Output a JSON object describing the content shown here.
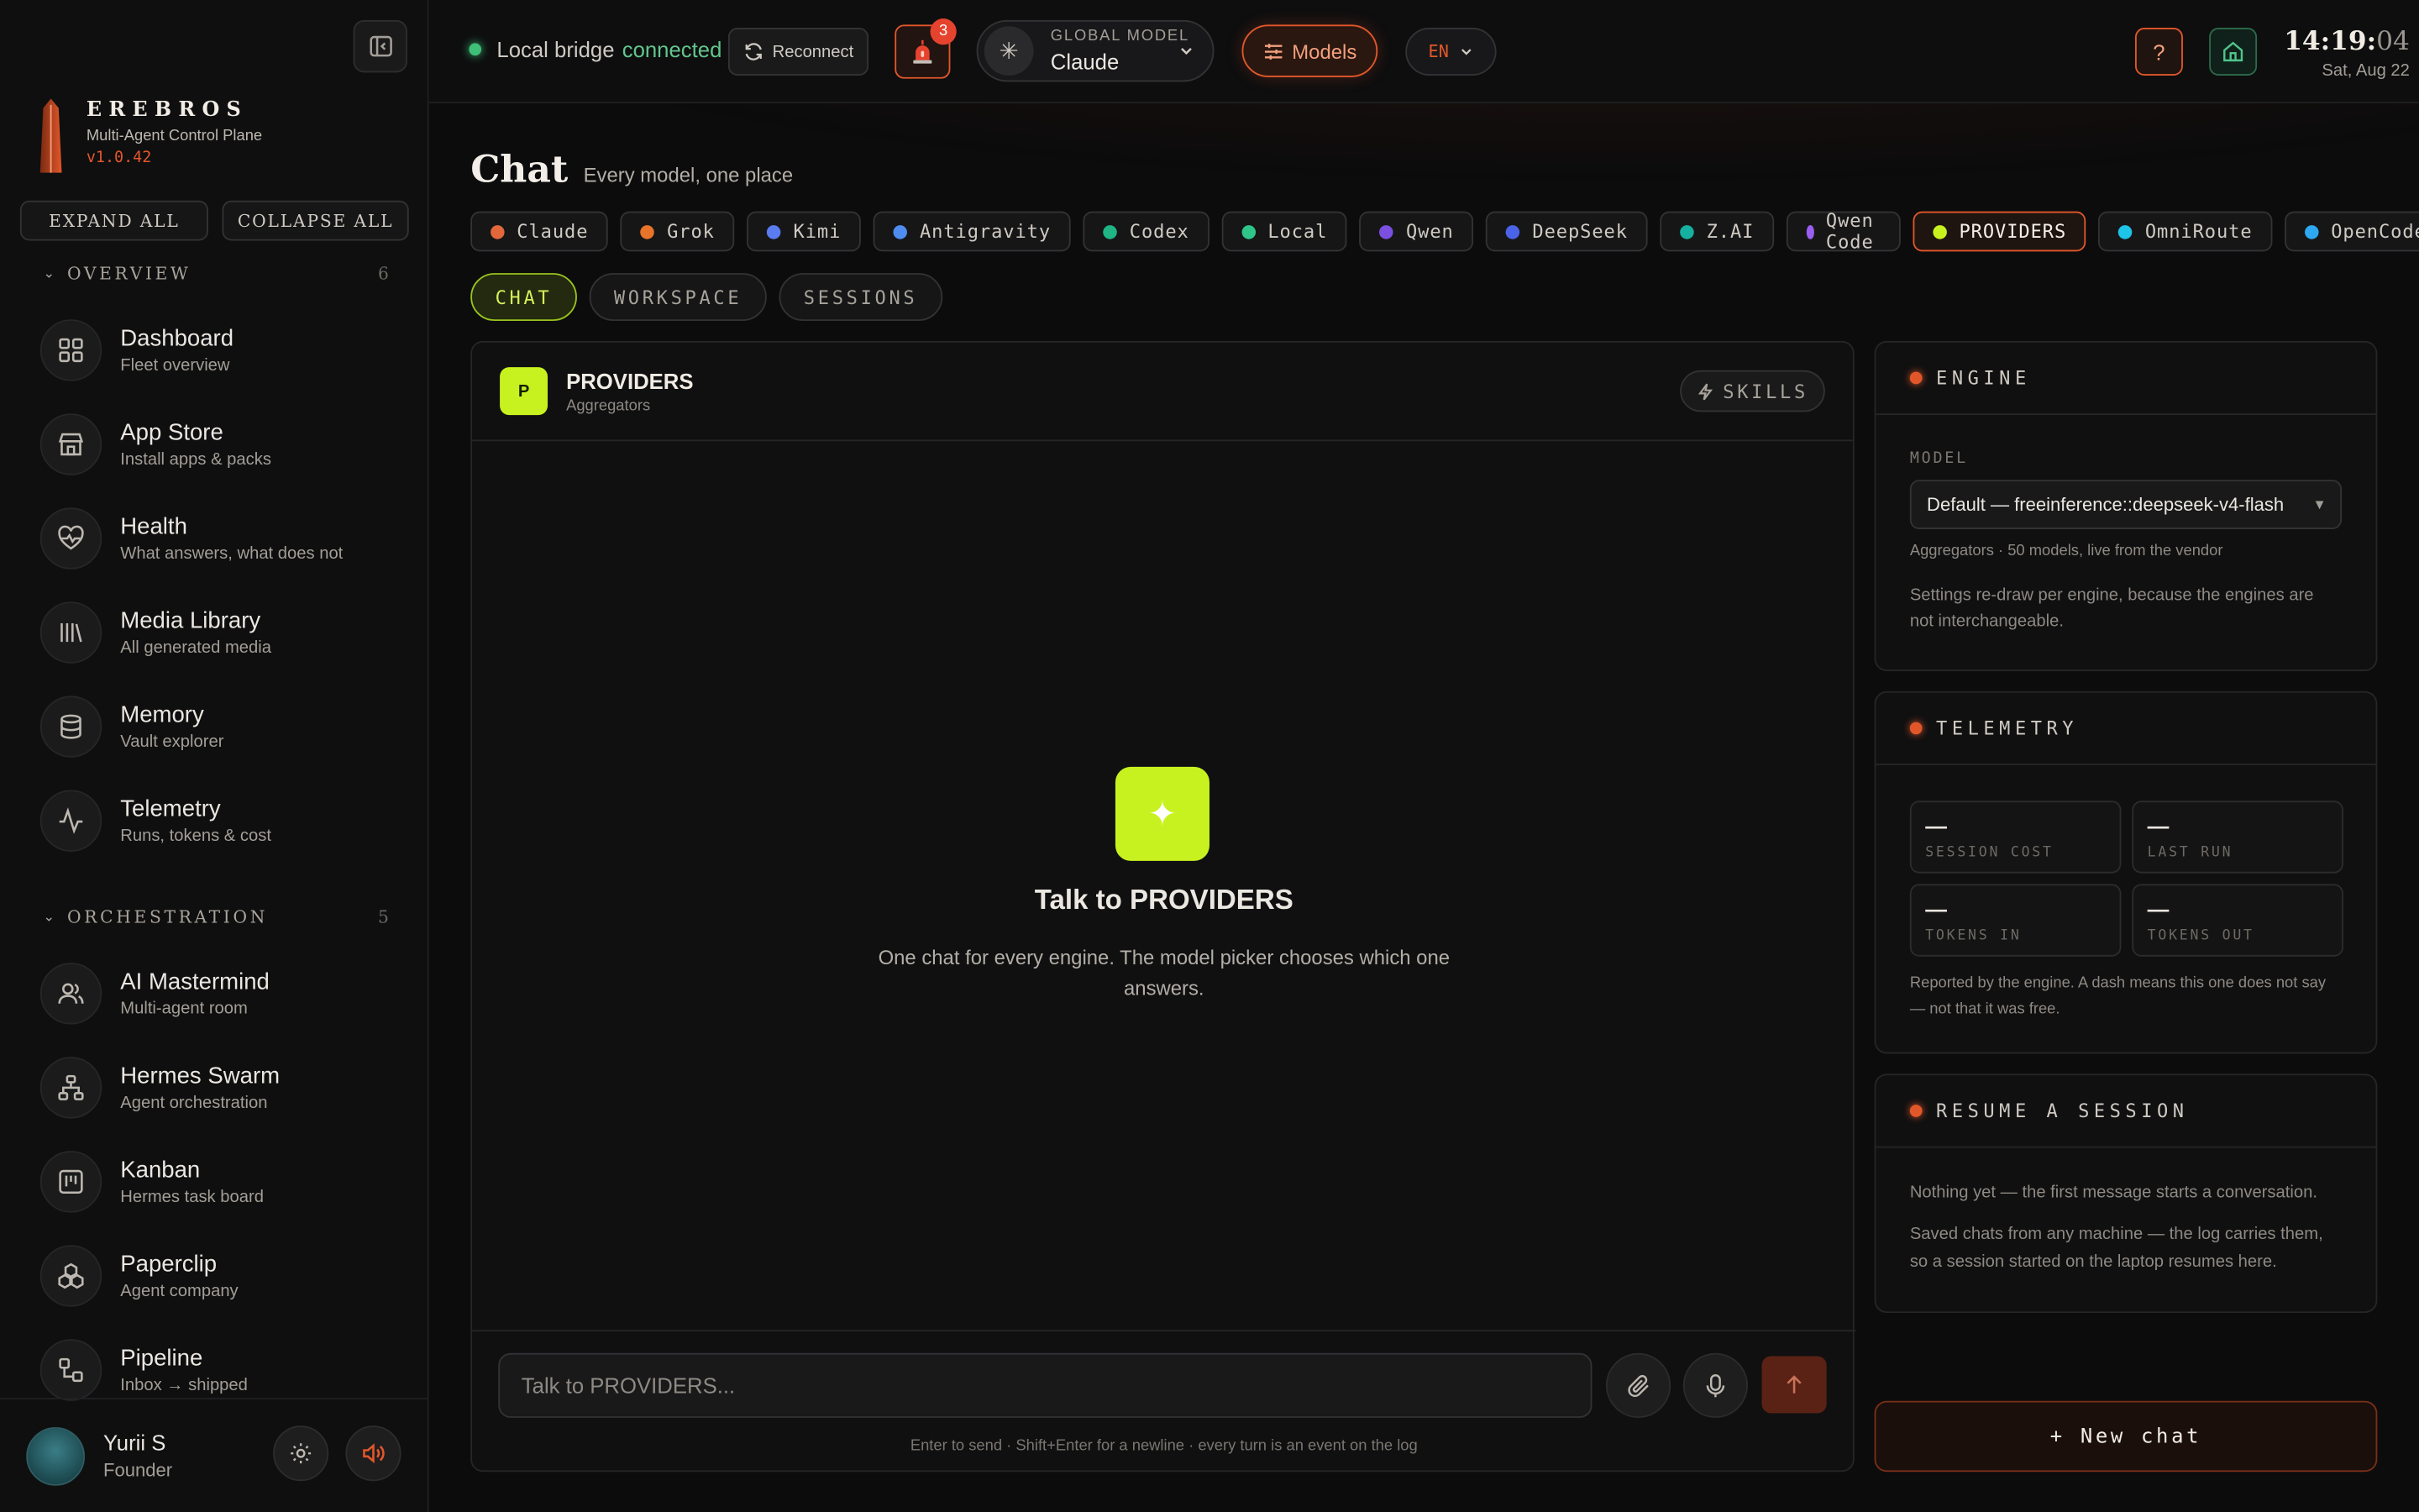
{
  "sidebar": {
    "brand": {
      "name": "EREBROS",
      "subtitle": "Multi-Agent Control Plane",
      "version": "v1.0.42"
    },
    "expand_label": "EXPAND ALL",
    "collapse_label": "COLLAPSE ALL",
    "groups": [
      {
        "label": "OVERVIEW",
        "count": "6",
        "items": [
          {
            "title": "Dashboard",
            "sub": "Fleet overview",
            "icon": "grid-icon"
          },
          {
            "title": "App Store",
            "sub": "Install apps & packs",
            "icon": "store-icon"
          },
          {
            "title": "Health",
            "sub": "What answers, what does not",
            "icon": "heart-pulse-icon"
          },
          {
            "title": "Media Library",
            "sub": "All generated media",
            "icon": "library-icon"
          },
          {
            "title": "Memory",
            "sub": "Vault explorer",
            "icon": "database-icon"
          },
          {
            "title": "Telemetry",
            "sub": "Runs, tokens & cost",
            "icon": "activity-icon"
          }
        ]
      },
      {
        "label": "ORCHESTRATION",
        "count": "5",
        "items": [
          {
            "title": "AI Mastermind",
            "sub": "Multi-agent room",
            "icon": "users-icon"
          },
          {
            "title": "Hermes Swarm",
            "sub": "Agent orchestration",
            "icon": "network-icon"
          },
          {
            "title": "Kanban",
            "sub": "Hermes task board",
            "icon": "kanban-icon"
          },
          {
            "title": "Paperclip",
            "sub": "Agent company",
            "icon": "boxes-icon"
          },
          {
            "title": "Pipeline",
            "sub": "Inbox → shipped",
            "icon": "workflow-icon"
          }
        ]
      }
    ],
    "user": {
      "name": "Yurii S",
      "role": "Founder"
    }
  },
  "topbar": {
    "status_text": "Local bridge",
    "status_state": "connected",
    "reconnect_label": "Reconnect",
    "alert_count": "3",
    "global_model_label": "GLOBAL MODEL",
    "global_model_value": "Claude",
    "models_label": "Models",
    "lang": "EN",
    "help_label": "?",
    "clock_hm": "14:19:",
    "clock_sec": "04",
    "date": "Sat, Aug 22"
  },
  "page": {
    "title": "Chat",
    "subtitle": "Every model, one place"
  },
  "engines": [
    {
      "name": "Claude",
      "color": "#e2683c"
    },
    {
      "name": "Grok",
      "color": "#e8742a"
    },
    {
      "name": "Kimi",
      "color": "#5b7cf0"
    },
    {
      "name": "Antigravity",
      "color": "#4f8cf0"
    },
    {
      "name": "Codex",
      "color": "#1fb585"
    },
    {
      "name": "Local",
      "color": "#2fc58a"
    },
    {
      "name": "Qwen",
      "color": "#7b4fe0"
    },
    {
      "name": "DeepSeek",
      "color": "#4a63e8"
    },
    {
      "name": "Z.AI",
      "color": "#16b0a0"
    },
    {
      "name": "Qwen Code",
      "color": "#9a5ef0"
    },
    {
      "name": "PROVIDERS",
      "color": "#c8f21f",
      "active": true
    },
    {
      "name": "OmniRoute",
      "color": "#1ec3e8"
    },
    {
      "name": "OpenCode",
      "color": "#2ea8f0"
    }
  ],
  "subtabs": [
    "CHAT",
    "WORKSPACE",
    "SESSIONS"
  ],
  "chat": {
    "logo_letter": "P",
    "title": "PROVIDERS",
    "subtitle": "Aggregators",
    "skills_label": "SKILLS",
    "empty_title": "Talk to PROVIDERS",
    "empty_sub": "One chat for every engine. The model picker chooses which one answers.",
    "input_placeholder": "Talk to PROVIDERS...",
    "hint": "Enter to send · Shift+Enter for a newline · every turn is an event on the log"
  },
  "engine_panel": {
    "title": "ENGINE",
    "model_label": "MODEL",
    "model_value": "Default — freeinference::deepseek-v4-flash",
    "meta": "Aggregators · 50 models, live from the vendor",
    "note": "Settings re-draw per engine, because the engines are not interchangeable."
  },
  "telemetry": {
    "title": "TELEMETRY",
    "cells": [
      {
        "value": "—",
        "label": "SESSION COST"
      },
      {
        "value": "—",
        "label": "LAST RUN"
      },
      {
        "value": "—",
        "label": "TOKENS IN"
      },
      {
        "value": "—",
        "label": "TOKENS OUT"
      }
    ],
    "note": "Reported by the engine. A dash means this one does not say — not that it was free."
  },
  "resume": {
    "title": "RESUME A SESSION",
    "line1": "Nothing yet — the first message starts a conversation.",
    "line2": "Saved chats from any machine — the log carries them, so a session started on the laptop resumes here."
  },
  "new_chat_label": "+ New chat",
  "colors": {
    "accent": "#e2572a",
    "lime": "#c8f21f",
    "ok": "#3fbf77"
  }
}
